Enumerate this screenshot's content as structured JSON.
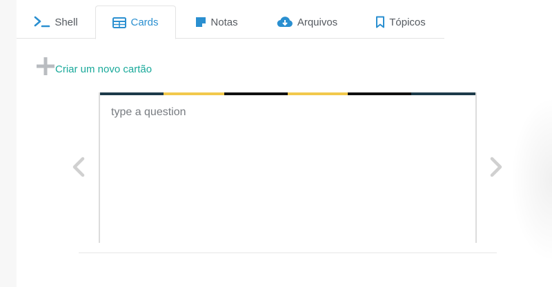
{
  "tabs": [
    {
      "label": "Shell",
      "icon": "terminal-icon"
    },
    {
      "label": "Cards",
      "icon": "table-icon",
      "active": true
    },
    {
      "label": "Notas",
      "icon": "sticky-note-icon"
    },
    {
      "label": "Arquivos",
      "icon": "cloud-download-icon"
    },
    {
      "label": "Tópicos",
      "icon": "bookmark-icon"
    }
  ],
  "new_card": {
    "label": "Criar um novo cartão",
    "icon": "plus-icon"
  },
  "card": {
    "question_placeholder": "type a question",
    "stripe_colors": [
      "#1d3b4a",
      "#f2c94c",
      "#111111",
      "#f2c94c",
      "#111111",
      "#1d3b4a"
    ]
  },
  "navigation": {
    "prev_icon": "chevron-left-icon",
    "next_icon": "chevron-right-icon"
  },
  "colors": {
    "accent_blue": "#2a8fd0",
    "accent_teal": "#19a99a",
    "icon_gray": "#b9bcc0",
    "arrow_gray": "#d0d0d0"
  }
}
